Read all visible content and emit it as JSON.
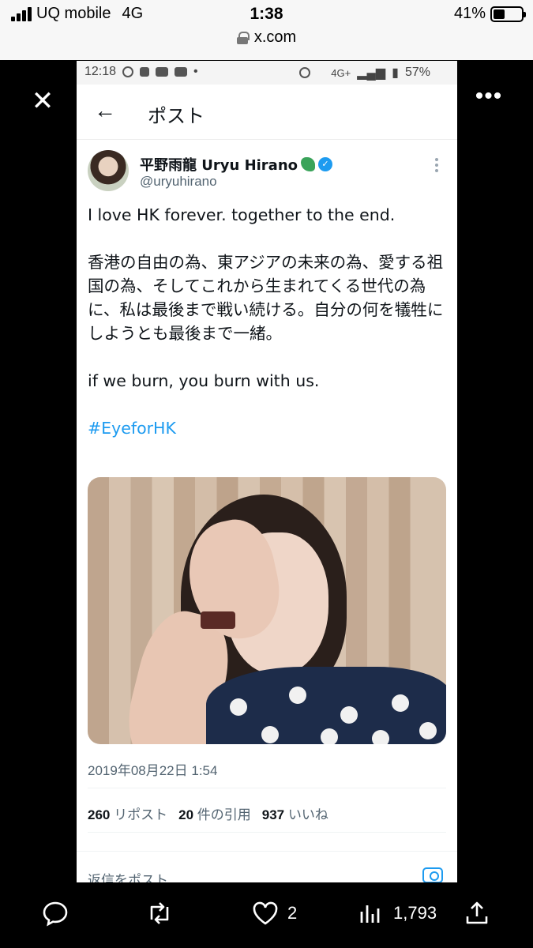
{
  "phone_status": {
    "carrier": "UQ mobile",
    "network": "4G",
    "time": "1:38",
    "battery": "41%",
    "battery_level": 0.41,
    "url": "x.com"
  },
  "inner_status": {
    "time": "12:18",
    "network": "4G+",
    "battery": "57%"
  },
  "header": {
    "title": "ポスト"
  },
  "post": {
    "author_name": "平野雨龍 Uryu Hirano",
    "handle": "@uryuhirano",
    "text_line1": "I love HK forever. together to the end.",
    "text_jp": "香港の自由の為、東アジアの未来の為、愛する祖国の為、そしてこれから生まれてくる世代の為に、私は最後まで戦い続ける。自分の何を犠牲にしようとも最後まで一緒。",
    "text_line3": "if we burn, you burn with us.",
    "hashtag": "#EyeforHK",
    "timestamp": "2019年08月22日 1:54",
    "reposts_count": "260",
    "reposts_label": "リポスト",
    "quotes_count": "20",
    "quotes_label": "件の引用",
    "likes_count": "937",
    "likes_label": "いいね"
  },
  "reply": {
    "placeholder": "返信をポスト"
  },
  "actions": {
    "likes": "2",
    "views": "1,793"
  }
}
